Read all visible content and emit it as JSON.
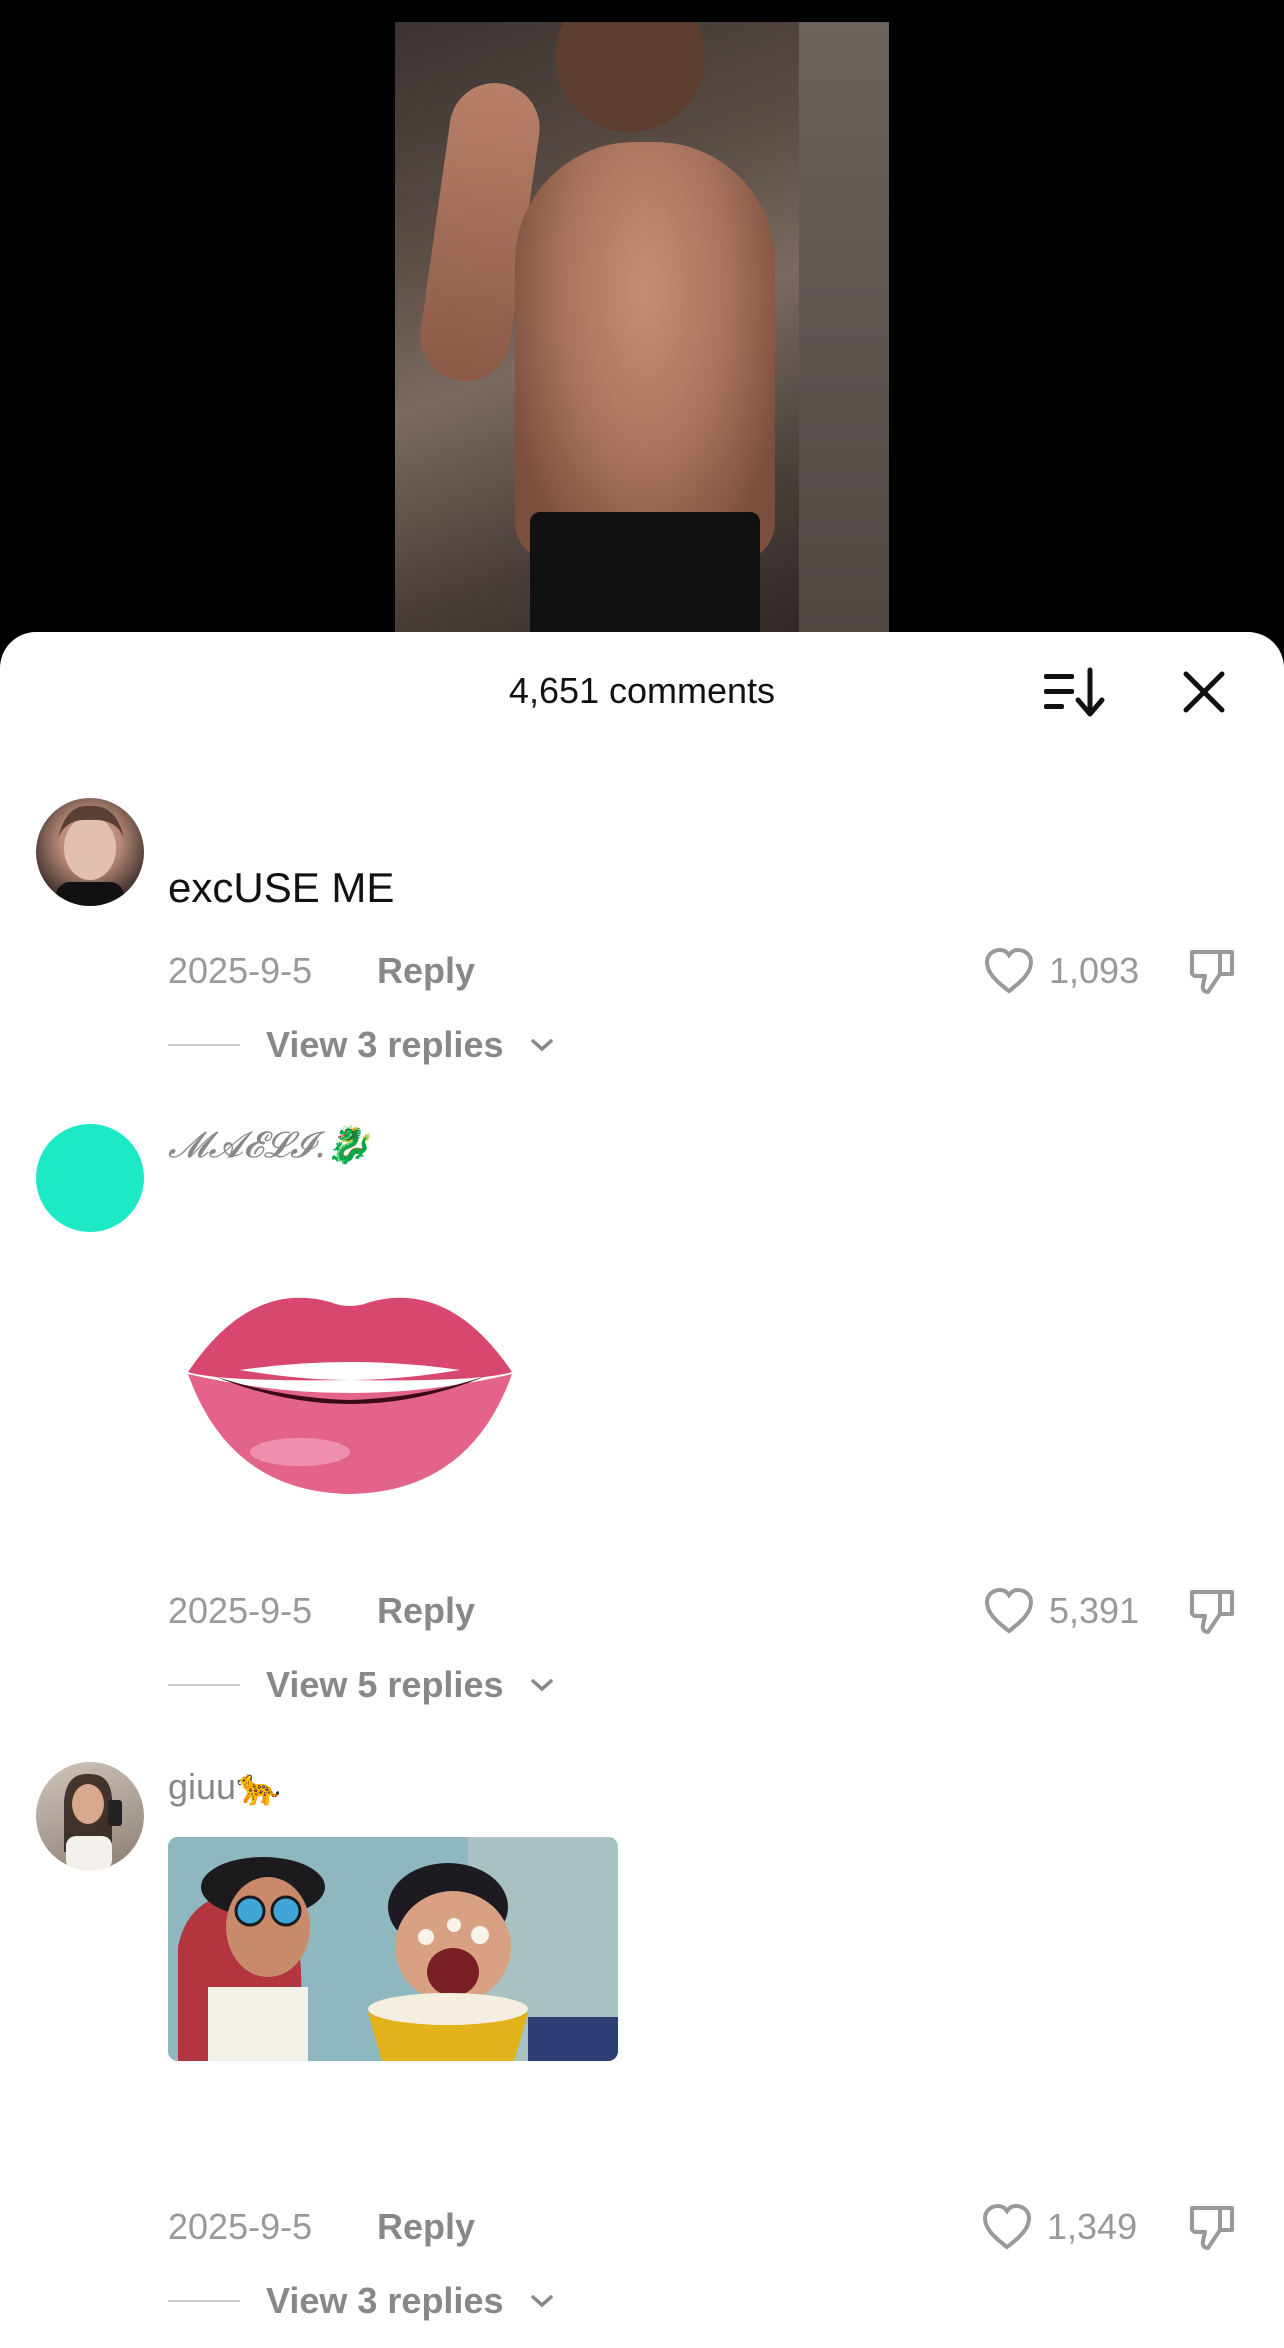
{
  "sheet": {
    "title": "4,651 comments"
  },
  "icons": {
    "sort": "sort-icon",
    "close": "close-icon",
    "like": "heart-icon",
    "dislike": "thumbs-down-icon",
    "chevron": "chevron-down-icon"
  },
  "comments": [
    {
      "username": "",
      "text": "excUSE ME",
      "date": "2025-9-5",
      "reply_label": "Reply",
      "likes": "1,093",
      "view_replies": "View 3 replies"
    },
    {
      "username": "𝓜𝓐𝓔𝓛𝓘.🐉",
      "sticker": "lips-emoji-sticker",
      "date": "2025-9-5",
      "reply_label": "Reply",
      "likes": "5,391",
      "view_replies": "View 5 replies"
    },
    {
      "username": "giuu🐆",
      "image": "popcorn-animation-gif",
      "date": "2025-9-5",
      "reply_label": "Reply",
      "likes": "1,349",
      "view_replies": "View 3 replies"
    }
  ],
  "colors": {
    "avatar2": "#1de9c7",
    "text_primary": "#111111",
    "text_secondary": "#888888"
  }
}
